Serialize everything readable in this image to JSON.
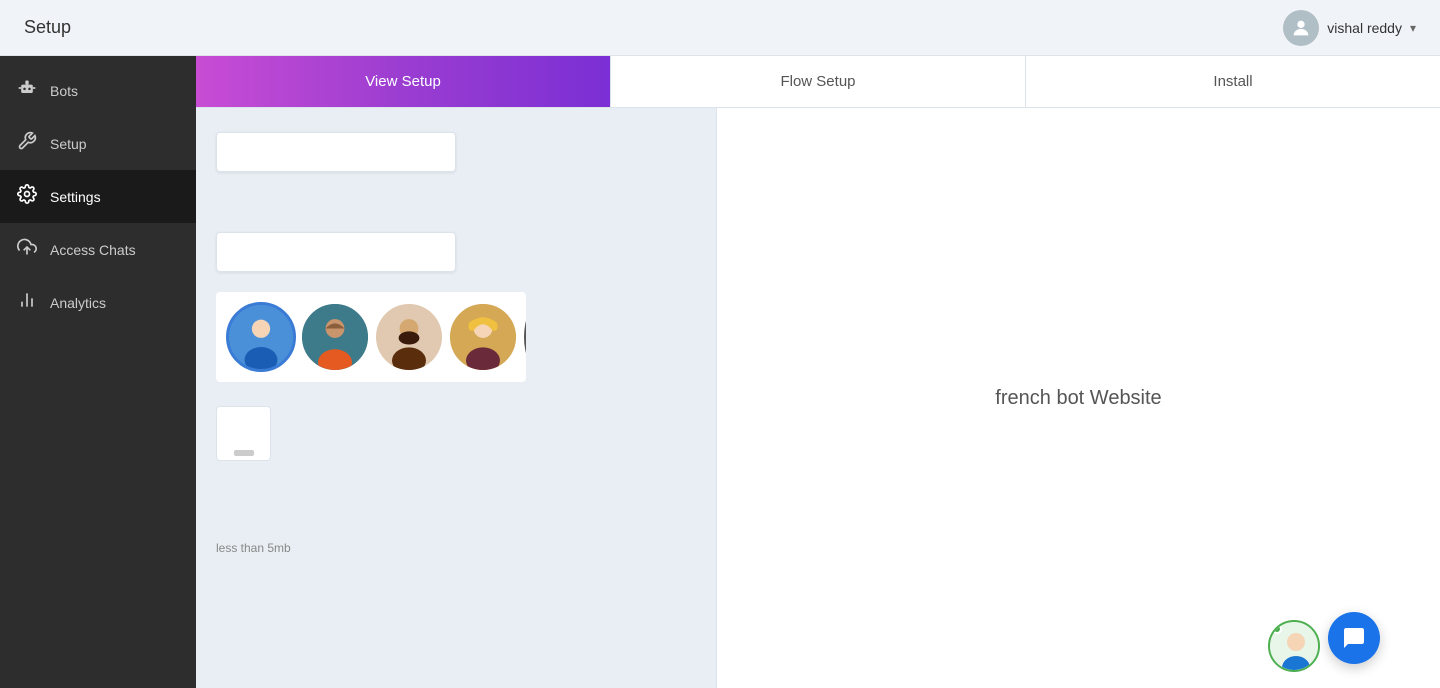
{
  "header": {
    "title": "Setup",
    "user": {
      "name": "vishal reddy",
      "dropdown_arrow": "▾"
    }
  },
  "sidebar": {
    "items": [
      {
        "id": "bots",
        "label": "Bots",
        "icon": "🤖"
      },
      {
        "id": "setup",
        "label": "Setup",
        "icon": "🔧",
        "active": false
      },
      {
        "id": "settings",
        "label": "Settings",
        "icon": "⚙️",
        "active": true
      },
      {
        "id": "access-chats",
        "label": "Access Chats",
        "icon": "☁️",
        "active": false
      },
      {
        "id": "analytics",
        "label": "Analytics",
        "icon": "📊",
        "active": false
      }
    ]
  },
  "tabs": [
    {
      "id": "view-setup",
      "label": "View Setup",
      "active": true
    },
    {
      "id": "flow-setup",
      "label": "Flow Setup",
      "active": false
    },
    {
      "id": "install",
      "label": "Install",
      "active": false
    }
  ],
  "main": {
    "preview_title": "french bot Website",
    "file_size_hint": "less than 5mb"
  }
}
